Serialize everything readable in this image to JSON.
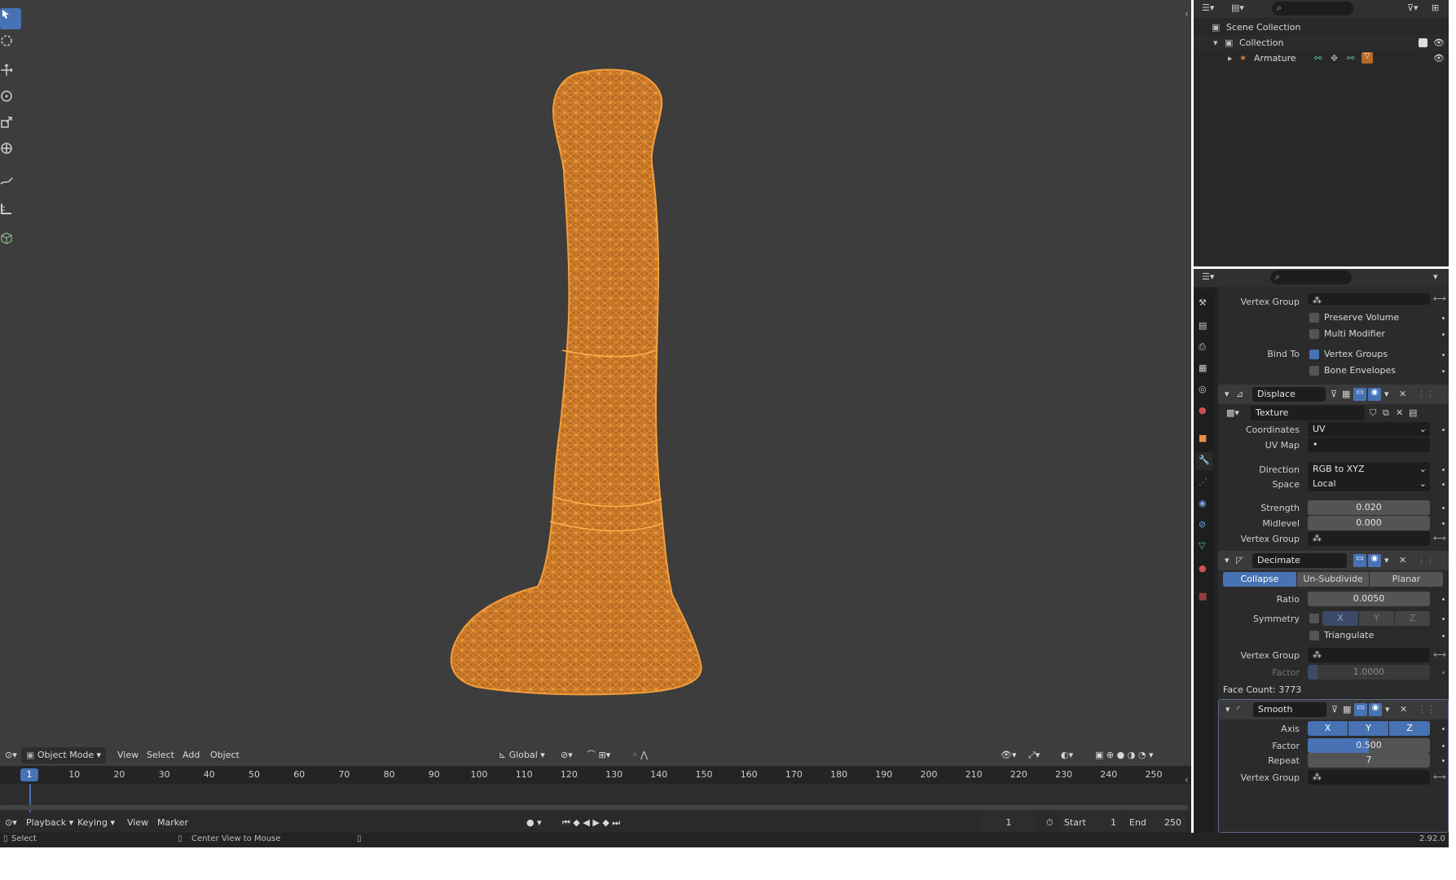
{
  "viewport": {
    "header": {
      "mode": "Object Mode",
      "menus": [
        "View",
        "Select",
        "Add",
        "Object"
      ],
      "transform_orientation": "Global"
    }
  },
  "timeline": {
    "ticks": [
      "10",
      "20",
      "30",
      "40",
      "50",
      "60",
      "70",
      "80",
      "90",
      "100",
      "110",
      "120",
      "130",
      "140",
      "150",
      "160",
      "170",
      "180",
      "190",
      "200",
      "210",
      "220",
      "230",
      "240",
      "250"
    ],
    "current_frame_badge": "1",
    "menus": [
      "Playback",
      "Keying",
      "View",
      "Marker"
    ],
    "current_frame": "1",
    "start_label": "Start",
    "start_value": "1",
    "end_label": "End",
    "end_value": "250"
  },
  "statusbar": {
    "left": "Select",
    "middle": "Center View to Mouse",
    "version": "2.92.0"
  },
  "outliner": {
    "scene_collection": "Scene Collection",
    "collection": "Collection",
    "armature": "Armature"
  },
  "properties": {
    "armature_mod": {
      "vertex_group_label": "Vertex Group",
      "preserve_volume": "Preserve Volume",
      "multi_modifier": "Multi Modifier",
      "bind_to_label": "Bind To",
      "vertex_groups": "Vertex Groups",
      "bone_envelopes": "Bone Envelopes"
    },
    "displace": {
      "name": "Displace",
      "texture": "Texture",
      "coordinates_label": "Coordinates",
      "coordinates_value": "UV",
      "uvmap_label": "UV Map",
      "direction_label": "Direction",
      "direction_value": "RGB to XYZ",
      "space_label": "Space",
      "space_value": "Local",
      "strength_label": "Strength",
      "strength_value": "0.020",
      "midlevel_label": "Midlevel",
      "midlevel_value": "0.000",
      "vertex_group_label": "Vertex Group"
    },
    "decimate": {
      "name": "Decimate",
      "tabs": [
        "Collapse",
        "Un-Subdivide",
        "Planar"
      ],
      "ratio_label": "Ratio",
      "ratio_value": "0.0050",
      "symmetry_label": "Symmetry",
      "axes": [
        "X",
        "Y",
        "Z"
      ],
      "triangulate": "Triangulate",
      "vertex_group_label": "Vertex Group",
      "factor_label": "Factor",
      "factor_value": "1.0000",
      "face_count": "Face Count: 3773"
    },
    "smooth": {
      "name": "Smooth",
      "axis_label": "Axis",
      "axes": [
        "X",
        "Y",
        "Z"
      ],
      "factor_label": "Factor",
      "factor_value": "0.500",
      "repeat_label": "Repeat",
      "repeat_value": "7",
      "vertex_group_label": "Vertex Group"
    }
  },
  "colors": {
    "accent": "#4772b3",
    "mesh_wire": "#f5a03a",
    "viewport_bg": "#3d3d3d"
  }
}
